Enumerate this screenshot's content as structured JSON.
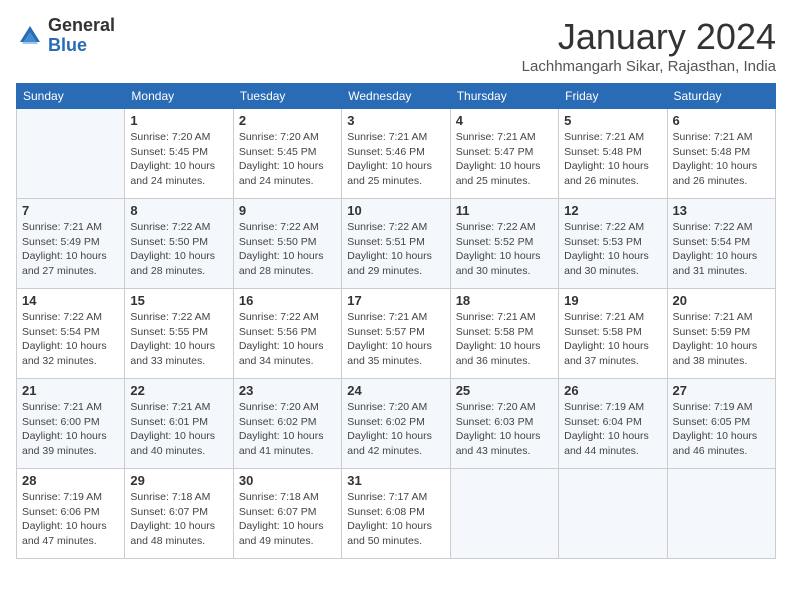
{
  "logo": {
    "general": "General",
    "blue": "Blue"
  },
  "title": "January 2024",
  "subtitle": "Lachhmangarh Sikar, Rajasthan, India",
  "days_of_week": [
    "Sunday",
    "Monday",
    "Tuesday",
    "Wednesday",
    "Thursday",
    "Friday",
    "Saturday"
  ],
  "weeks": [
    [
      {
        "day": "",
        "info": ""
      },
      {
        "day": "1",
        "info": "Sunrise: 7:20 AM\nSunset: 5:45 PM\nDaylight: 10 hours\nand 24 minutes."
      },
      {
        "day": "2",
        "info": "Sunrise: 7:20 AM\nSunset: 5:45 PM\nDaylight: 10 hours\nand 24 minutes."
      },
      {
        "day": "3",
        "info": "Sunrise: 7:21 AM\nSunset: 5:46 PM\nDaylight: 10 hours\nand 25 minutes."
      },
      {
        "day": "4",
        "info": "Sunrise: 7:21 AM\nSunset: 5:47 PM\nDaylight: 10 hours\nand 25 minutes."
      },
      {
        "day": "5",
        "info": "Sunrise: 7:21 AM\nSunset: 5:48 PM\nDaylight: 10 hours\nand 26 minutes."
      },
      {
        "day": "6",
        "info": "Sunrise: 7:21 AM\nSunset: 5:48 PM\nDaylight: 10 hours\nand 26 minutes."
      }
    ],
    [
      {
        "day": "7",
        "info": "Sunrise: 7:21 AM\nSunset: 5:49 PM\nDaylight: 10 hours\nand 27 minutes."
      },
      {
        "day": "8",
        "info": "Sunrise: 7:22 AM\nSunset: 5:50 PM\nDaylight: 10 hours\nand 28 minutes."
      },
      {
        "day": "9",
        "info": "Sunrise: 7:22 AM\nSunset: 5:50 PM\nDaylight: 10 hours\nand 28 minutes."
      },
      {
        "day": "10",
        "info": "Sunrise: 7:22 AM\nSunset: 5:51 PM\nDaylight: 10 hours\nand 29 minutes."
      },
      {
        "day": "11",
        "info": "Sunrise: 7:22 AM\nSunset: 5:52 PM\nDaylight: 10 hours\nand 30 minutes."
      },
      {
        "day": "12",
        "info": "Sunrise: 7:22 AM\nSunset: 5:53 PM\nDaylight: 10 hours\nand 30 minutes."
      },
      {
        "day": "13",
        "info": "Sunrise: 7:22 AM\nSunset: 5:54 PM\nDaylight: 10 hours\nand 31 minutes."
      }
    ],
    [
      {
        "day": "14",
        "info": "Sunrise: 7:22 AM\nSunset: 5:54 PM\nDaylight: 10 hours\nand 32 minutes."
      },
      {
        "day": "15",
        "info": "Sunrise: 7:22 AM\nSunset: 5:55 PM\nDaylight: 10 hours\nand 33 minutes."
      },
      {
        "day": "16",
        "info": "Sunrise: 7:22 AM\nSunset: 5:56 PM\nDaylight: 10 hours\nand 34 minutes."
      },
      {
        "day": "17",
        "info": "Sunrise: 7:21 AM\nSunset: 5:57 PM\nDaylight: 10 hours\nand 35 minutes."
      },
      {
        "day": "18",
        "info": "Sunrise: 7:21 AM\nSunset: 5:58 PM\nDaylight: 10 hours\nand 36 minutes."
      },
      {
        "day": "19",
        "info": "Sunrise: 7:21 AM\nSunset: 5:58 PM\nDaylight: 10 hours\nand 37 minutes."
      },
      {
        "day": "20",
        "info": "Sunrise: 7:21 AM\nSunset: 5:59 PM\nDaylight: 10 hours\nand 38 minutes."
      }
    ],
    [
      {
        "day": "21",
        "info": "Sunrise: 7:21 AM\nSunset: 6:00 PM\nDaylight: 10 hours\nand 39 minutes."
      },
      {
        "day": "22",
        "info": "Sunrise: 7:21 AM\nSunset: 6:01 PM\nDaylight: 10 hours\nand 40 minutes."
      },
      {
        "day": "23",
        "info": "Sunrise: 7:20 AM\nSunset: 6:02 PM\nDaylight: 10 hours\nand 41 minutes."
      },
      {
        "day": "24",
        "info": "Sunrise: 7:20 AM\nSunset: 6:02 PM\nDaylight: 10 hours\nand 42 minutes."
      },
      {
        "day": "25",
        "info": "Sunrise: 7:20 AM\nSunset: 6:03 PM\nDaylight: 10 hours\nand 43 minutes."
      },
      {
        "day": "26",
        "info": "Sunrise: 7:19 AM\nSunset: 6:04 PM\nDaylight: 10 hours\nand 44 minutes."
      },
      {
        "day": "27",
        "info": "Sunrise: 7:19 AM\nSunset: 6:05 PM\nDaylight: 10 hours\nand 46 minutes."
      }
    ],
    [
      {
        "day": "28",
        "info": "Sunrise: 7:19 AM\nSunset: 6:06 PM\nDaylight: 10 hours\nand 47 minutes."
      },
      {
        "day": "29",
        "info": "Sunrise: 7:18 AM\nSunset: 6:07 PM\nDaylight: 10 hours\nand 48 minutes."
      },
      {
        "day": "30",
        "info": "Sunrise: 7:18 AM\nSunset: 6:07 PM\nDaylight: 10 hours\nand 49 minutes."
      },
      {
        "day": "31",
        "info": "Sunrise: 7:17 AM\nSunset: 6:08 PM\nDaylight: 10 hours\nand 50 minutes."
      },
      {
        "day": "",
        "info": ""
      },
      {
        "day": "",
        "info": ""
      },
      {
        "day": "",
        "info": ""
      }
    ]
  ]
}
